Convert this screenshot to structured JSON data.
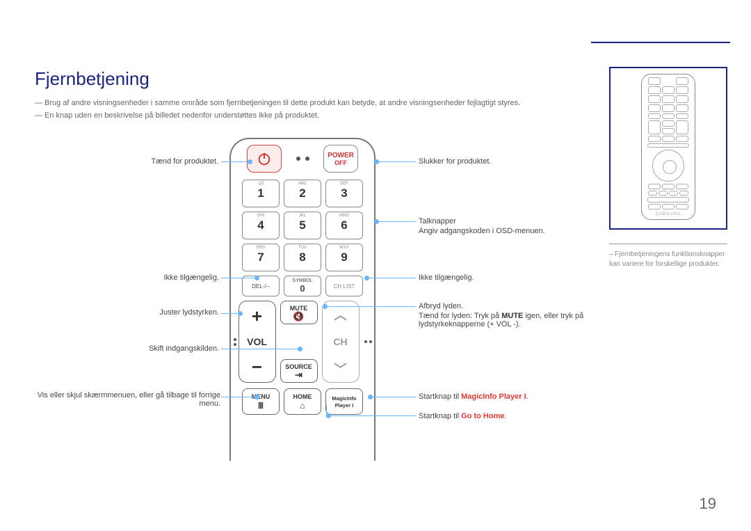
{
  "title": "Fjernbetjening",
  "notes": [
    "Brug af andre visningsenheder i samme område som fjernbetjeningen til dette produkt kan betyde, at andre visningsenheder fejlagtigt styres.",
    "En knap uden en beskrivelse på billedet nedenfor understøttes ikke på produktet."
  ],
  "left": {
    "power_on": "Tænd for produktet.",
    "na": "Ikke tilgængelig.",
    "vol": "Juster lydstyrken.",
    "source": "Skift indgangskilden.",
    "menu": "Vis eller skjul skærmmenuen, eller gå tilbage til forrige menu."
  },
  "right": {
    "power_off": "Slukker for produktet.",
    "numbers_l1": "Talknapper",
    "numbers_l2": "Angiv adgangskoden i OSD-menuen.",
    "na": "Ikke tilgængelig.",
    "mute_l1": "Afbryd lyden.",
    "mute_l2_a": "Tænd for lyden: Tryk på ",
    "mute_l2_b": "MUTE",
    "mute_l2_c": " igen, eller tryk på lydstyrkeknapperne (+  VOL  -).",
    "magic_a": "Startknap til ",
    "magic_b": "MagicInfo Player I",
    "magic_c": ".",
    "home_a": "Startknap til ",
    "home_b": "Go to Home",
    "home_c": "."
  },
  "remote": {
    "power_off": "POWER",
    "power_off_sub": "OFF",
    "keypad_sub": [
      ".QZ",
      "ABC",
      "DEF",
      "GHI",
      "JKL",
      "MNO",
      "PRS",
      "TUV",
      "WXY"
    ],
    "keypad_num": [
      "1",
      "2",
      "3",
      "4",
      "5",
      "6",
      "7",
      "8",
      "9"
    ],
    "del": "DEL-/--",
    "symbol": "SYMBOL",
    "zero": "0",
    "chlist": "CH LIST",
    "vol": "VOL",
    "ch": "CH",
    "mute": "MUTE",
    "source": "SOURCE",
    "menu": "MENU",
    "home": "HOME",
    "magic_l1": "MagicInfo",
    "magic_l2": "Player I"
  },
  "side": {
    "brand": "SAMSUNG",
    "caption": "Fjernbetjeningens funktionsknapper kan variere for forskellige produkter."
  },
  "page": "19"
}
